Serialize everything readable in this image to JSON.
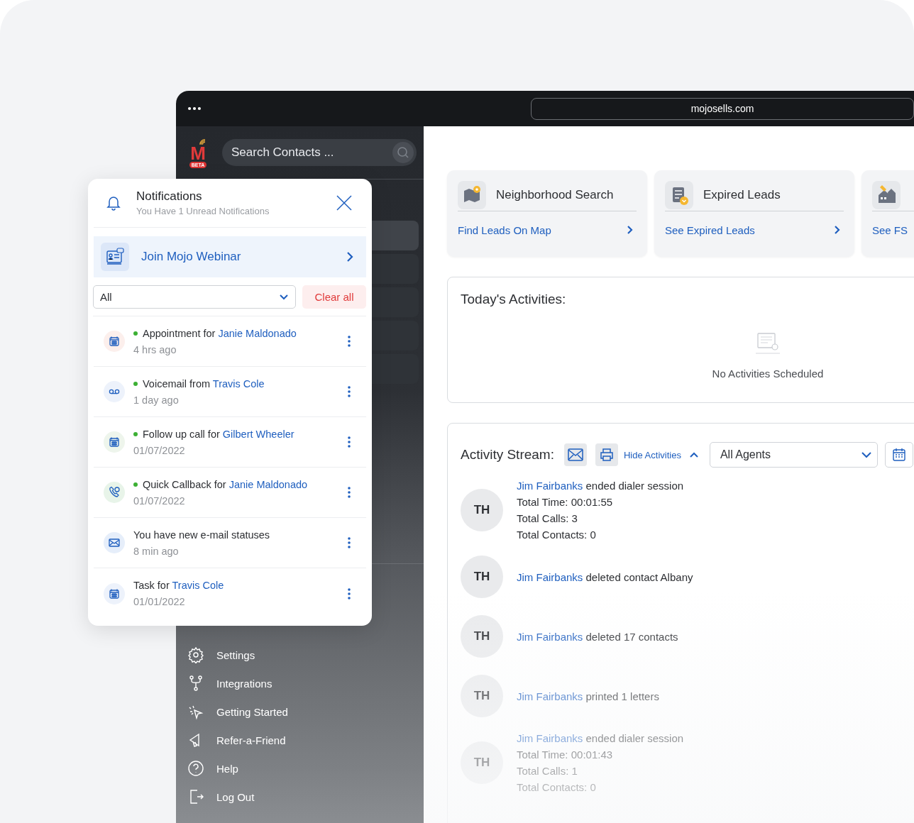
{
  "browser": {
    "url": "mojosells.com"
  },
  "sidebar": {
    "logo": {
      "letter": "M",
      "badge": "BETA"
    },
    "search": {
      "placeholder": "Search Contacts ..."
    },
    "hidden_items": [
      {
        "selected": true
      },
      {
        "selected": false
      },
      {
        "selected": false
      },
      {
        "selected": false
      },
      {
        "selected": false
      }
    ],
    "items": [
      {
        "kind": "settings",
        "label": "Settings"
      },
      {
        "kind": "integrations",
        "label": "Integrations"
      },
      {
        "kind": "start",
        "label": "Getting Started"
      },
      {
        "kind": "refer",
        "label": "Refer-a-Friend"
      },
      {
        "kind": "help",
        "label": "Help"
      },
      {
        "kind": "logout",
        "label": "Log Out"
      }
    ]
  },
  "shortcuts": [
    {
      "kind": "map",
      "title": "Neighborhood Search",
      "link": "Find Leads On Map",
      "arrow": true
    },
    {
      "kind": "expired",
      "title": "Expired Leads",
      "link": "See Expired Leads",
      "arrow": true
    },
    {
      "kind": "house",
      "link": "See FS"
    }
  ],
  "today": {
    "title": "Today's Activities:",
    "empty": "No Activities Scheduled"
  },
  "stream": {
    "title": "Activity Stream:",
    "toggle": "Hide Activities",
    "agent_filter": "All Agents",
    "items": [
      {
        "initials": "TH",
        "actor": "Jim Fairbanks",
        "action": "ended dialer session",
        "details": [
          "Total Time: 00:01:55",
          "Total Calls: 3",
          "Total Contacts: 0"
        ]
      },
      {
        "initials": "TH",
        "actor": "Jim Fairbanks",
        "action": "deleted contact Albany"
      },
      {
        "initials": "TH",
        "actor": "Jim Fairbanks",
        "action": "deleted 17 contacts"
      },
      {
        "initials": "TH",
        "actor": "Jim Fairbanks",
        "action": "printed 1 letters"
      },
      {
        "initials": "TH",
        "actor": "Jim Fairbanks",
        "action": "ended dialer session",
        "details": [
          "Total Time: 00:01:43",
          "Total Calls: 1",
          "Total Contacts: 0"
        ]
      }
    ]
  },
  "notifications": {
    "title": "Notifications",
    "subtitle": "You Have 1 Unread Notifications",
    "banner": "Join Mojo Webinar",
    "filter": "All",
    "clear": "Clear all",
    "items": [
      {
        "kind": "calendar",
        "color": "#fcefec",
        "unread": true,
        "text": "Appointment for ",
        "contact": "Janie Maldonado",
        "time": "4 hrs ago"
      },
      {
        "kind": "voicemail",
        "color": "#edf2fb",
        "unread": true,
        "text": "Voicemail from ",
        "contact": "Travis Cole",
        "time": "1 day ago"
      },
      {
        "kind": "calendar",
        "color": "#eef5ec",
        "unread": true,
        "text": "Follow up call for ",
        "contact": "Gilbert Wheeler",
        "time": "01/07/2022"
      },
      {
        "kind": "phone",
        "color": "#e8f4e9",
        "unread": true,
        "text": "Quick Callback for ",
        "contact": "Janie Maldonado",
        "time": "01/07/2022"
      },
      {
        "kind": "mail",
        "color": "#e6eefa",
        "unread": false,
        "text": "You have new e-mail statuses",
        "time": "8 min ago"
      },
      {
        "kind": "calendar",
        "color": "#edf2fb",
        "unread": false,
        "text": "Task for ",
        "contact": "Travis Cole",
        "time": "01/01/2022"
      }
    ]
  }
}
